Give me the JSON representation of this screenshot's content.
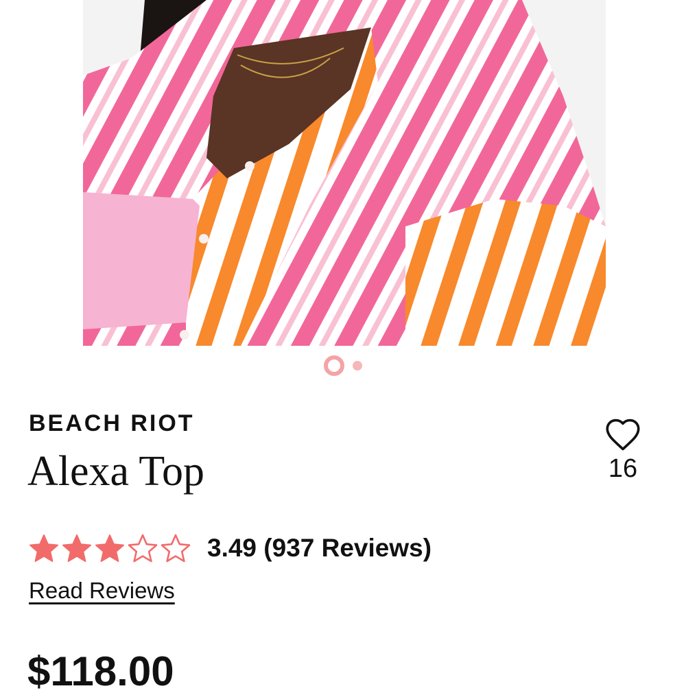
{
  "gallery": {
    "image_alt": "Model wearing striped pink, orange and white button-up shirt over pink ribbed bralette",
    "slide_count": 2,
    "active_slide": 1
  },
  "product": {
    "brand": "BEACH RIOT",
    "title": "Alexa Top",
    "price": "$118.00"
  },
  "favorite": {
    "icon": "heart-outline-icon",
    "count": "16"
  },
  "rating": {
    "value": 3.49,
    "max": 5,
    "text": "3.49 (937 Reviews)",
    "read_reviews_label": "Read Reviews",
    "star_color": "#f26b6b"
  },
  "colors": {
    "accent": "#f26b6b",
    "pager_active": "#f4a4a6",
    "pager_inactive": "#f7b6b8"
  }
}
